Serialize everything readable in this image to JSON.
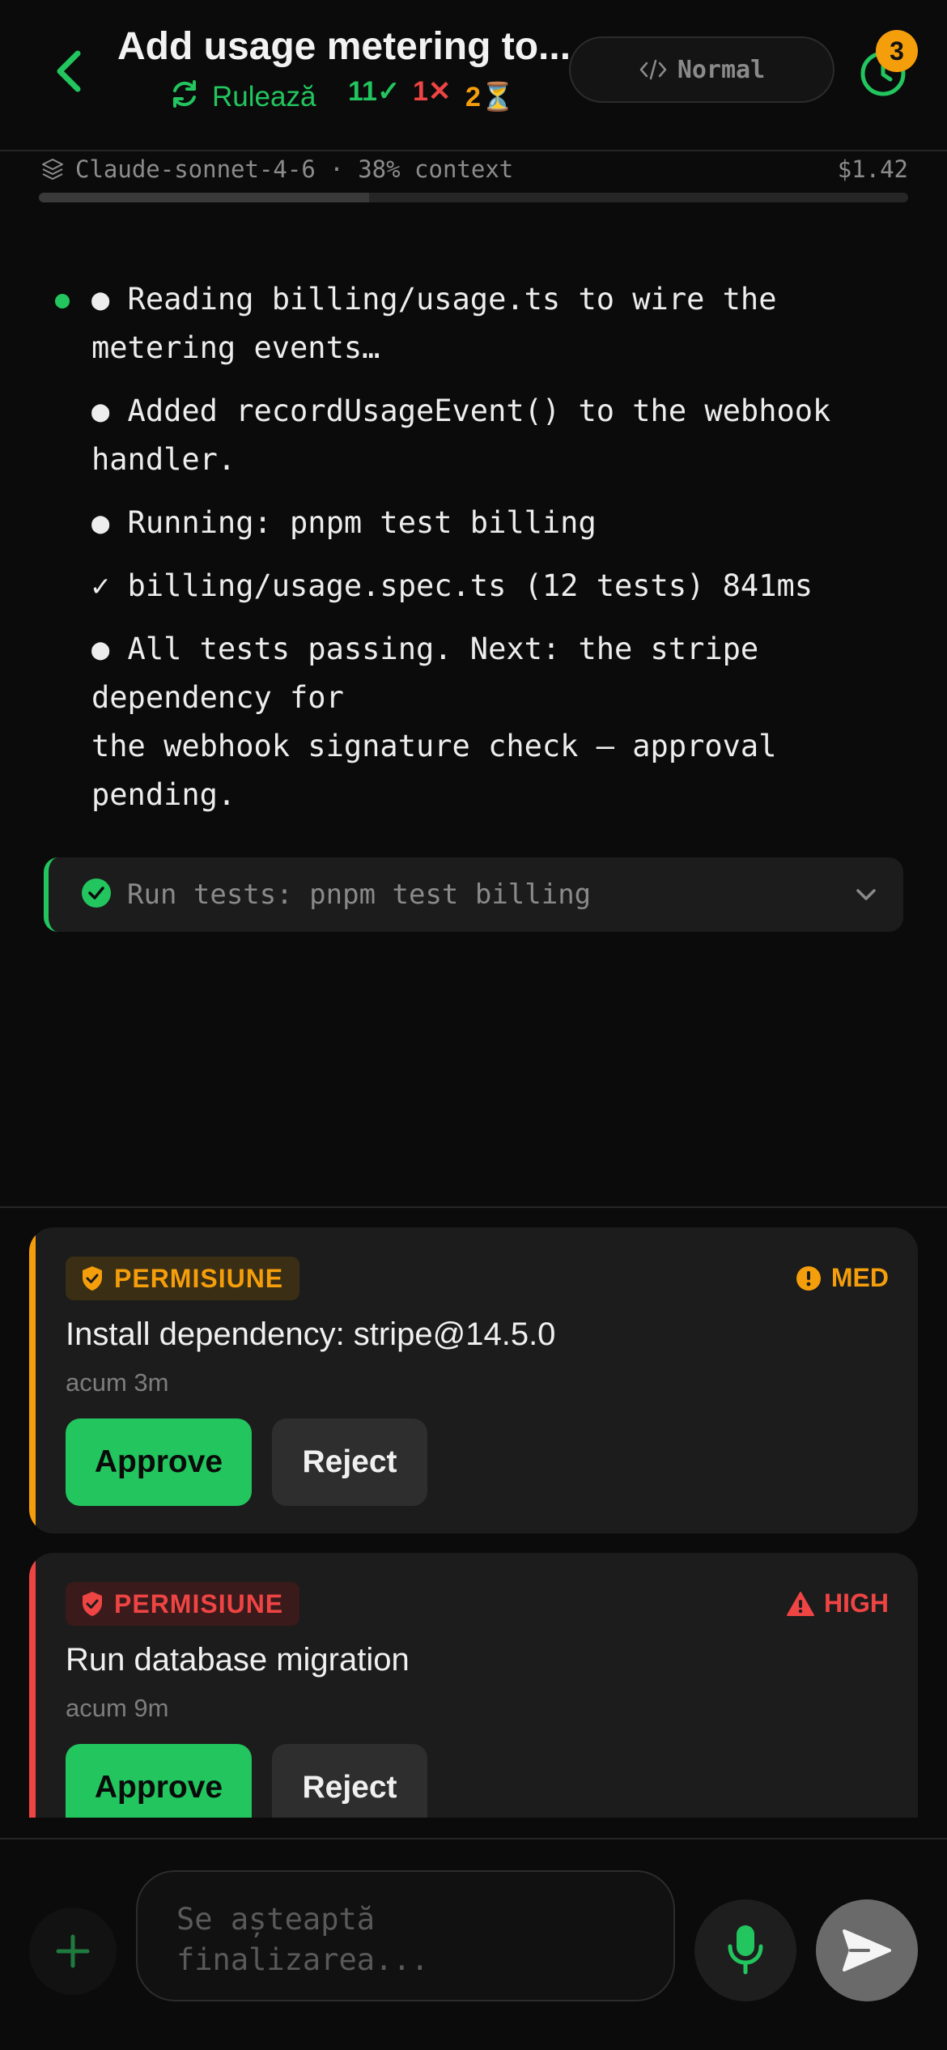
{
  "header": {
    "title": "Add usage metering to...",
    "status": "Rulează",
    "stats": {
      "ok": "11✓",
      "err": "1✕",
      "wait": "2⏳"
    },
    "mode": "Normal",
    "badge_count": "3",
    "icons": {
      "back": "chevron-left-icon",
      "status": "sync-icon",
      "mode": "code-icon",
      "history": "clock-icon"
    }
  },
  "context": {
    "text": "Claude-sonnet-4-6 · 38% context",
    "cost": "$1.42",
    "percent": 38,
    "icon": "layers-icon"
  },
  "log": {
    "lines": [
      "● Reading billing/usage.ts to wire the metering events…",
      "● Added recordUsageEvent() to the webhook handler.",
      "● Running: pnpm test billing",
      "✓ billing/usage.spec.ts (12 tests) 841ms",
      "● All tests passing. Next: the stripe dependency for\nthe webhook signature check — approval pending."
    ]
  },
  "tool": {
    "label": "Run tests: pnpm test billing",
    "status": "success",
    "icons": {
      "status": "check-circle-icon",
      "expand": "chevron-down-icon"
    }
  },
  "permissions": [
    {
      "tag": "PERMISIUNE",
      "risk": "MED",
      "title": "Install dependency: stripe@14.5.0",
      "time": "acum 3m",
      "approve": "Approve",
      "reject": "Reject",
      "color": "#f59e0b"
    },
    {
      "tag": "PERMISIUNE",
      "risk": "HIGH",
      "title": "Run database migration",
      "time": "acum 9m",
      "approve": "Approve",
      "reject": "Reject",
      "color": "#ef4444"
    }
  ],
  "composer": {
    "placeholder": "Se așteaptă\nfinalizarea...",
    "icons": {
      "add": "plus-icon",
      "mic": "microphone-icon",
      "send": "send-icon"
    }
  },
  "colors": {
    "accent": "#22c55e",
    "warning": "#f59e0b",
    "danger": "#ef4444",
    "background": "#0b0b0b"
  }
}
